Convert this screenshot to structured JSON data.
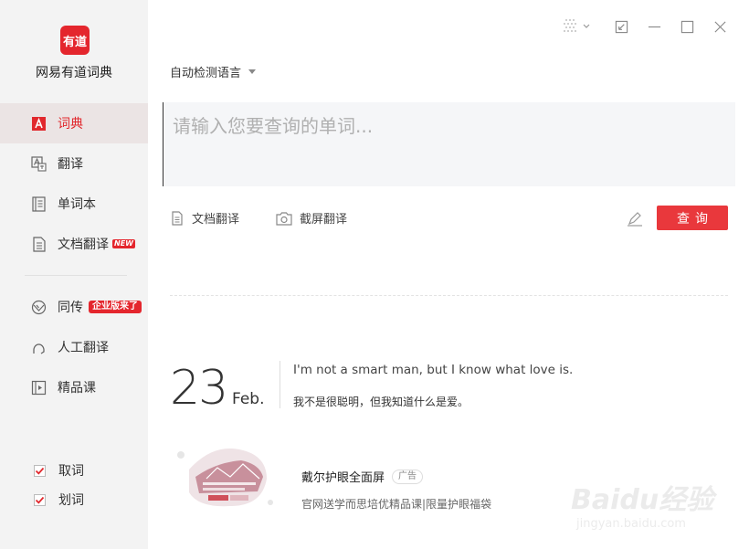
{
  "app": {
    "logo_text": "有道",
    "name": "网易有道词典"
  },
  "sidebar": {
    "items": [
      {
        "label": "词典"
      },
      {
        "label": "翻译"
      },
      {
        "label": "单词本"
      },
      {
        "label": "文档翻译",
        "badge": "NEW"
      },
      {
        "label": "同传",
        "badge": "企业版来了"
      },
      {
        "label": "人工翻译"
      },
      {
        "label": "精品课"
      }
    ],
    "checkboxes": [
      {
        "label": "取词",
        "checked": true
      },
      {
        "label": "划词",
        "checked": true
      }
    ]
  },
  "search": {
    "language": "自动检测语言",
    "placeholder": "请输入您要查询的单词...",
    "value": ""
  },
  "tools": {
    "doc_translate": "文档翻译",
    "screenshot_translate": "截屏翻译",
    "query_button": "查询"
  },
  "daily": {
    "day": "23",
    "month": "Feb.",
    "quote_en": "I'm not a smart man, but I know what love is.",
    "quote_cn": "我不是很聪明，但我知道什么是爱。"
  },
  "ad": {
    "title": "戴尔护眼全面屏",
    "tag": "广告",
    "description": "官网送学而思培优精品课|限量护眼福袋"
  },
  "watermark": {
    "main": "Baidu经验",
    "sub": "jingyan.baidu.com"
  },
  "colors": {
    "accent": "#e4262d",
    "button": "#e9383c",
    "sidebar_bg": "#f3f3f3"
  }
}
